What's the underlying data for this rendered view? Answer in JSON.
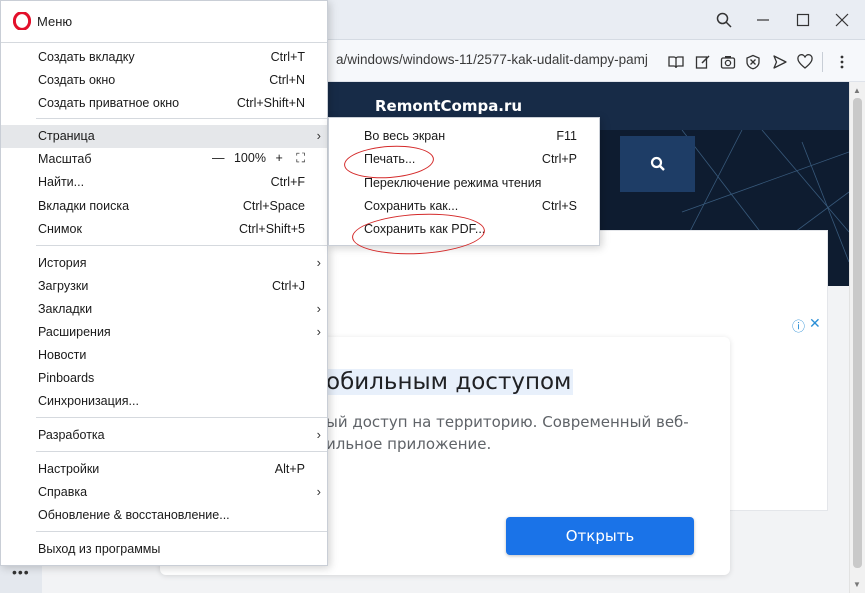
{
  "browser": {
    "url": "a/windows/windows-11/2577-kak-udalit-dampy-pamj",
    "toolbar_icons": [
      "book-icon",
      "pencil-icon",
      "camera-icon",
      "shield-icon",
      "send-icon",
      "heart-icon",
      "more-icon"
    ],
    "window_icons": [
      "search-icon",
      "minimize-icon",
      "maximize-icon",
      "close-icon"
    ]
  },
  "page": {
    "brand": "RemontCompa.ru",
    "ad": {
      "title": "обильным доступом",
      "desc_line1": "ый доступ на территорию. Современный веб-",
      "desc_line2": "ильное приложение.",
      "button": "Открыть",
      "info_icon": "ⓘ",
      "close_icon": "✕"
    }
  },
  "menu": {
    "title": "Меню",
    "items": [
      {
        "label": "Создать вкладку",
        "shortcut": "Ctrl+T"
      },
      {
        "label": "Создать окно",
        "shortcut": "Ctrl+N"
      },
      {
        "label": "Создать приватное окно",
        "shortcut": "Ctrl+Shift+N"
      },
      {
        "label": "Страница",
        "shortcut": ""
      },
      {
        "label": "Масштаб",
        "shortcut": ""
      },
      {
        "label": "Найти...",
        "shortcut": "Ctrl+F"
      },
      {
        "label": "Вкладки поиска",
        "shortcut": "Ctrl+Space"
      },
      {
        "label": "Снимок",
        "shortcut": "Ctrl+Shift+5"
      },
      {
        "label": "История",
        "shortcut": ""
      },
      {
        "label": "Загрузки",
        "shortcut": "Ctrl+J"
      },
      {
        "label": "Закладки",
        "shortcut": ""
      },
      {
        "label": "Расширения",
        "shortcut": ""
      },
      {
        "label": "Новости",
        "shortcut": ""
      },
      {
        "label": "Pinboards",
        "shortcut": ""
      },
      {
        "label": "Синхронизация...",
        "shortcut": ""
      },
      {
        "label": "Разработка",
        "shortcut": ""
      },
      {
        "label": "Настройки",
        "shortcut": "Alt+P"
      },
      {
        "label": "Справка",
        "shortcut": ""
      },
      {
        "label": "Обновление & восстановление...",
        "shortcut": ""
      },
      {
        "label": "Выход из программы",
        "shortcut": ""
      }
    ],
    "zoom": {
      "minus": "—",
      "value": "100%",
      "plus": "+",
      "fullscreen": "⛶"
    }
  },
  "submenu": {
    "items": [
      {
        "label": "Во весь экран",
        "shortcut": "F11"
      },
      {
        "label": "Печать...",
        "shortcut": "Ctrl+P"
      },
      {
        "label": "Переключение режима чтения",
        "shortcut": ""
      },
      {
        "label": "Сохранить как...",
        "shortcut": "Ctrl+S"
      },
      {
        "label": "Сохранить как PDF...",
        "shortcut": ""
      }
    ]
  },
  "colors": {
    "annotation": "#d42a2a",
    "opera_red": "#e3102b",
    "ad_button": "#1a73e8",
    "hero_bg": "#0e1c30"
  }
}
